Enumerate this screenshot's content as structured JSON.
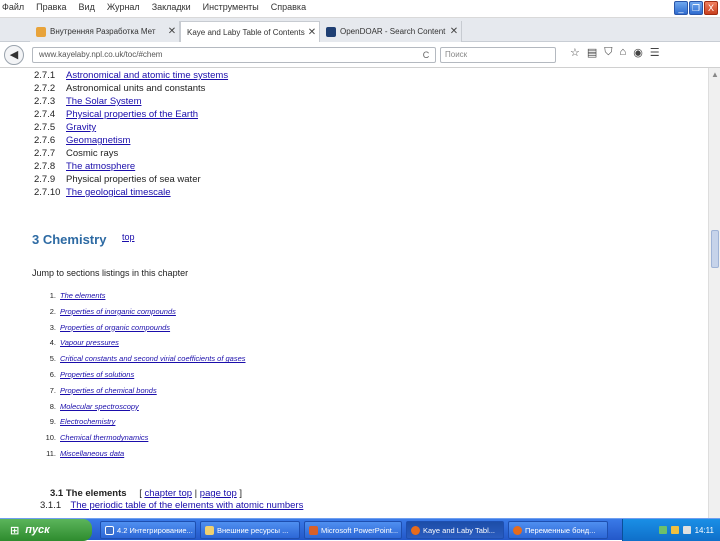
{
  "menu": [
    "Файл",
    "Правка",
    "Вид",
    "Журнал",
    "Закладки",
    "Инструменты",
    "Справка"
  ],
  "window_controls": [
    "_",
    "❐",
    "X"
  ],
  "tabs": [
    {
      "label": "Внутренняя Разработка Мет",
      "close": "✕",
      "active": false,
      "color": "#e8a33a"
    },
    {
      "label": "Kaye and Laby Table of Contents",
      "close": "✕",
      "active": true,
      "color": "#b8c2d0"
    },
    {
      "label": "OpenDOAR - Search Content",
      "close": "✕",
      "active": false,
      "color": "#1f3f73"
    }
  ],
  "new_tab": "+",
  "nav": {
    "back": "◀",
    "url": "www.kayelaby.npl.co.uk/toc/#chem",
    "reload": "C",
    "search_placeholder": "Поиск",
    "icons": [
      "☆",
      "▤",
      "⛉",
      "⌂",
      "◉",
      "☰"
    ]
  },
  "content": {
    "physics_subsections": [
      {
        "num": "2.7.1",
        "label": "Astronomical and atomic time systems",
        "link": true
      },
      {
        "num": "2.7.2",
        "label": "Astronomical units and constants",
        "link": false
      },
      {
        "num": "2.7.3",
        "label": "The Solar System",
        "link": true
      },
      {
        "num": "2.7.4",
        "label": "Physical properties of the Earth",
        "link": true
      },
      {
        "num": "2.7.5",
        "label": "Gravity",
        "link": true
      },
      {
        "num": "2.7.6",
        "label": "Geomagnetism",
        "link": true
      },
      {
        "num": "2.7.7",
        "label": "Cosmic rays",
        "link": false
      },
      {
        "num": "2.7.8",
        "label": "The atmosphere",
        "link": true
      },
      {
        "num": "2.7.9",
        "label": "Physical properties of sea water",
        "link": false
      },
      {
        "num": "2.7.10",
        "label": "The geological timescale",
        "link": true
      }
    ],
    "chapter_heading": "3 Chemistry",
    "edit_link": "top",
    "jump_text": "Jump to sections listings in this chapter",
    "chapter_items": [
      {
        "num": "1.",
        "label": "The elements"
      },
      {
        "num": "2.",
        "label": "Properties of inorganic compounds"
      },
      {
        "num": "3.",
        "label": "Properties of organic compounds"
      },
      {
        "num": "4.",
        "label": "Vapour pressures"
      },
      {
        "num": "5.",
        "label": "Critical constants and second virial coefficients of gases"
      },
      {
        "num": "6.",
        "label": "Properties of solutions"
      },
      {
        "num": "7.",
        "label": "Properties of chemical bonds"
      },
      {
        "num": "8.",
        "label": "Molecular spectroscopy"
      },
      {
        "num": "9.",
        "label": "Electrochemistry"
      },
      {
        "num": "10.",
        "label": "Chemical thermodynamics"
      },
      {
        "num": "11.",
        "label": "Miscellaneous data"
      }
    ],
    "section31": {
      "title": "3.1 The elements",
      "chapter_top": "chapter top",
      "page_top": "page top"
    },
    "section31_first": {
      "num": "3.1.1",
      "label": "The periodic table of the elements with atomic numbers"
    }
  },
  "taskbar": {
    "start": "пуск",
    "tasks": [
      {
        "label": "4.2 Интегрирование..."
      },
      {
        "label": "Внешние ресурсы ..."
      },
      {
        "label": "Microsoft PowerPoint..."
      },
      {
        "label": "Kaye and Laby Tabl..."
      },
      {
        "label": "Переменные бонд..."
      }
    ],
    "clock": "14:11"
  },
  "colors": {
    "heading": "#2d6aa3",
    "link": "#1a0dab",
    "taskbar": "#2358c9",
    "start": "#3c9a3c"
  }
}
